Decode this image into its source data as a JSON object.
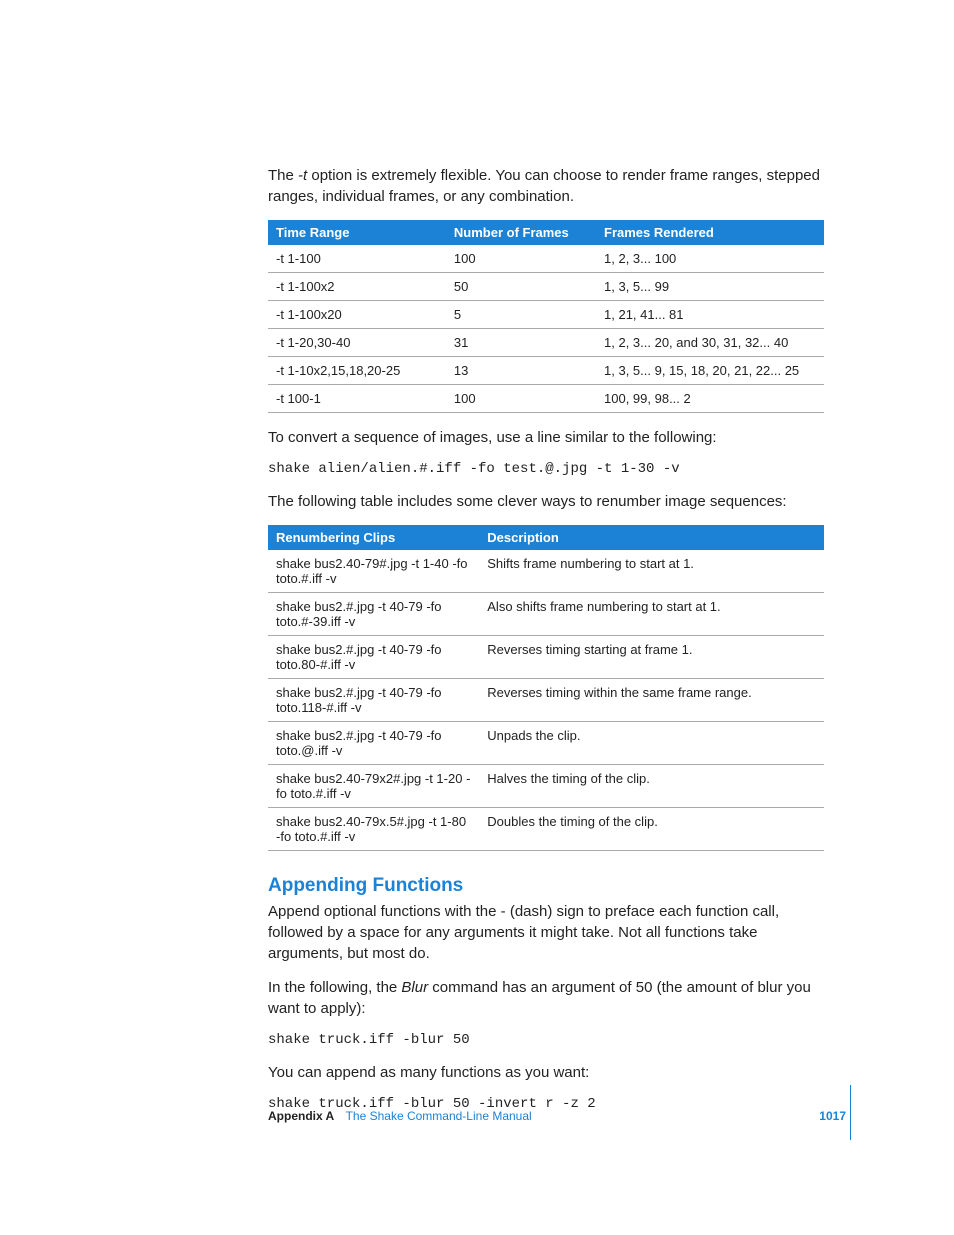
{
  "intro": {
    "prefix": "The ",
    "opt": "-t",
    "suffix": " option is extremely flexible. You can choose to render frame ranges, stepped ranges, individual frames, or any combination."
  },
  "table1": {
    "headers": [
      "Time Range",
      "Number of Frames",
      "Frames Rendered"
    ],
    "rows": [
      [
        "-t 1-100",
        "100",
        "1, 2, 3... 100"
      ],
      [
        "-t 1-100x2",
        "50",
        "1, 3, 5... 99"
      ],
      [
        "-t 1-100x20",
        "5",
        "1, 21, 41... 81"
      ],
      [
        "-t 1-20,30-40",
        "31",
        "1, 2, 3... 20, and 30, 31, 32... 40"
      ],
      [
        "-t 1-10x2,15,18,20-25",
        "13",
        "1, 3, 5... 9, 15, 18, 20, 21, 22... 25"
      ],
      [
        "-t 100-1",
        "100",
        "100, 99, 98... 2"
      ]
    ]
  },
  "p_convert": "To convert a sequence of images, use a line similar to the following:",
  "code1": "shake alien/alien.#.iff -fo test.@.jpg -t 1-30 -v",
  "p_clever": "The following table includes some clever ways to renumber image sequences:",
  "table2": {
    "headers": [
      "Renumbering Clips",
      "Description"
    ],
    "rows": [
      [
        "shake bus2.40-79#.jpg -t 1-40 -fo toto.#.iff -v",
        "Shifts frame numbering to start at 1."
      ],
      [
        "shake bus2.#.jpg -t 40-79 -fo toto.#-39.iff -v",
        "Also shifts frame numbering to start at 1."
      ],
      [
        "shake bus2.#.jpg -t 40-79 -fo toto.80-#.iff -v",
        "Reverses timing starting at frame 1."
      ],
      [
        "shake bus2.#.jpg -t 40-79 -fo toto.118-#.iff -v",
        "Reverses timing within the same frame range."
      ],
      [
        "shake bus2.#.jpg -t 40-79 -fo toto.@.iff -v",
        "Unpads the clip."
      ],
      [
        "shake bus2.40-79x2#.jpg -t 1-20 -fo toto.#.iff -v",
        "Halves the timing of the clip."
      ],
      [
        "shake bus2.40-79x.5#.jpg -t 1-80 -fo toto.#.iff -v",
        "Doubles the timing of the clip."
      ]
    ]
  },
  "section_title": "Appending Functions",
  "append_p1": "Append optional functions with the - (dash) sign to preface each function call, followed by a space for any arguments it might take. Not all functions take arguments, but most do.",
  "append_p2_prefix": "In the following, the ",
  "append_p2_ital": "Blur",
  "append_p2_suffix": " command has an argument of 50 (the amount of blur you want to apply):",
  "code2": "shake truck.iff -blur 50",
  "append_p3": "You can append as many functions as you want:",
  "code3": "shake truck.iff -blur 50 -invert r -z 2",
  "footer": {
    "appendix": "Appendix A",
    "title": "The Shake Command-Line Manual",
    "page": "1017"
  }
}
